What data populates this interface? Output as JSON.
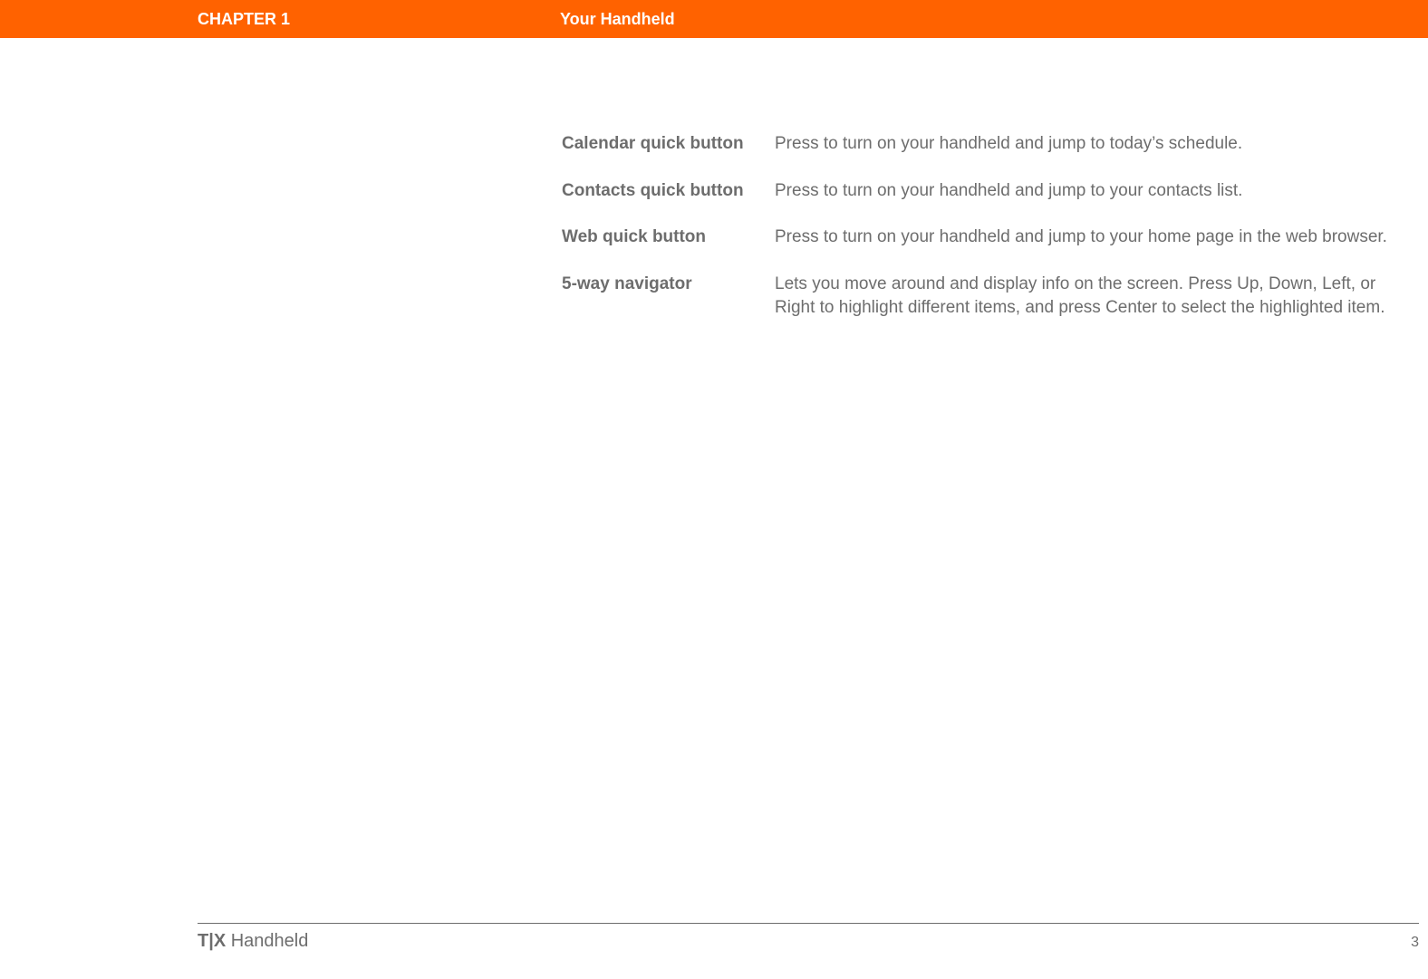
{
  "header": {
    "chapter": "CHAPTER 1",
    "title": "Your Handheld"
  },
  "rows": [
    {
      "label": "Calendar quick button",
      "desc": "Press to turn on your handheld and jump to today’s schedule."
    },
    {
      "label": "Contacts quick button",
      "desc": "Press to turn on your handheld and jump to your contacts list."
    },
    {
      "label": "Web quick button",
      "desc": "Press to turn on your handheld and jump to your home page in the web browser."
    },
    {
      "label": "5-way navigator",
      "desc": "Lets you move around and display info on the screen. Press Up, Down, Left, or Right to highlight different items, and press Center to select the highlighted item."
    }
  ],
  "footer": {
    "title_bold": "T|X",
    "title_rest": " Handheld",
    "page": "3"
  }
}
